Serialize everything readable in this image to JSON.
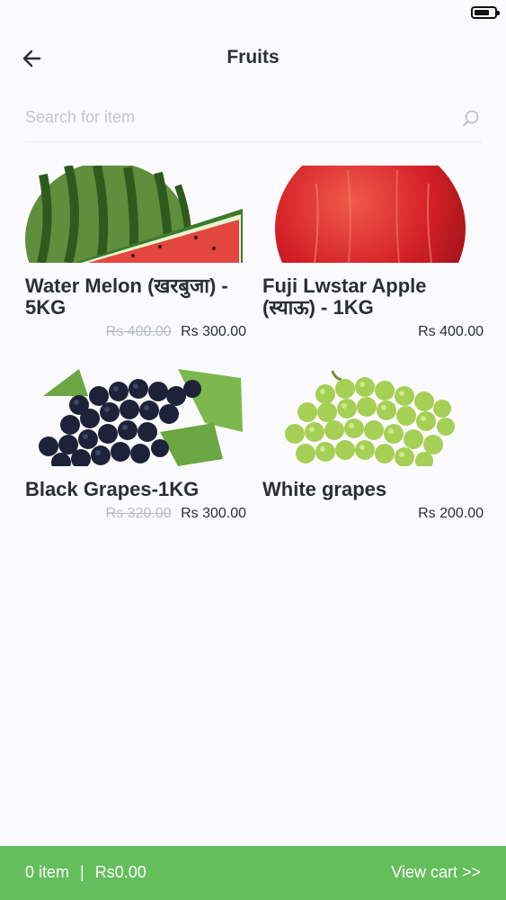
{
  "header": {
    "title": "Fruits"
  },
  "search": {
    "placeholder": "Search for item"
  },
  "products": [
    {
      "name": "Water Melon (खरबुजा) - 5KG",
      "old_price": "Rs 400.00",
      "price": "Rs 300.00"
    },
    {
      "name": "Fuji Lwstar Apple (स्याऊ) - 1KG",
      "old_price": "",
      "price": "Rs 400.00"
    },
    {
      "name": "Black Grapes-1KG",
      "old_price": "Rs 320.00",
      "price": "Rs 300.00"
    },
    {
      "name": "White grapes",
      "old_price": "",
      "price": "Rs 200.00"
    }
  ],
  "cart": {
    "items": "0 item",
    "separator": "|",
    "total": "Rs0.00",
    "view_label": "View cart >>"
  },
  "colors": {
    "accent": "#64be5c",
    "text": "#2b2f33",
    "muted": "#b9bcc0"
  }
}
